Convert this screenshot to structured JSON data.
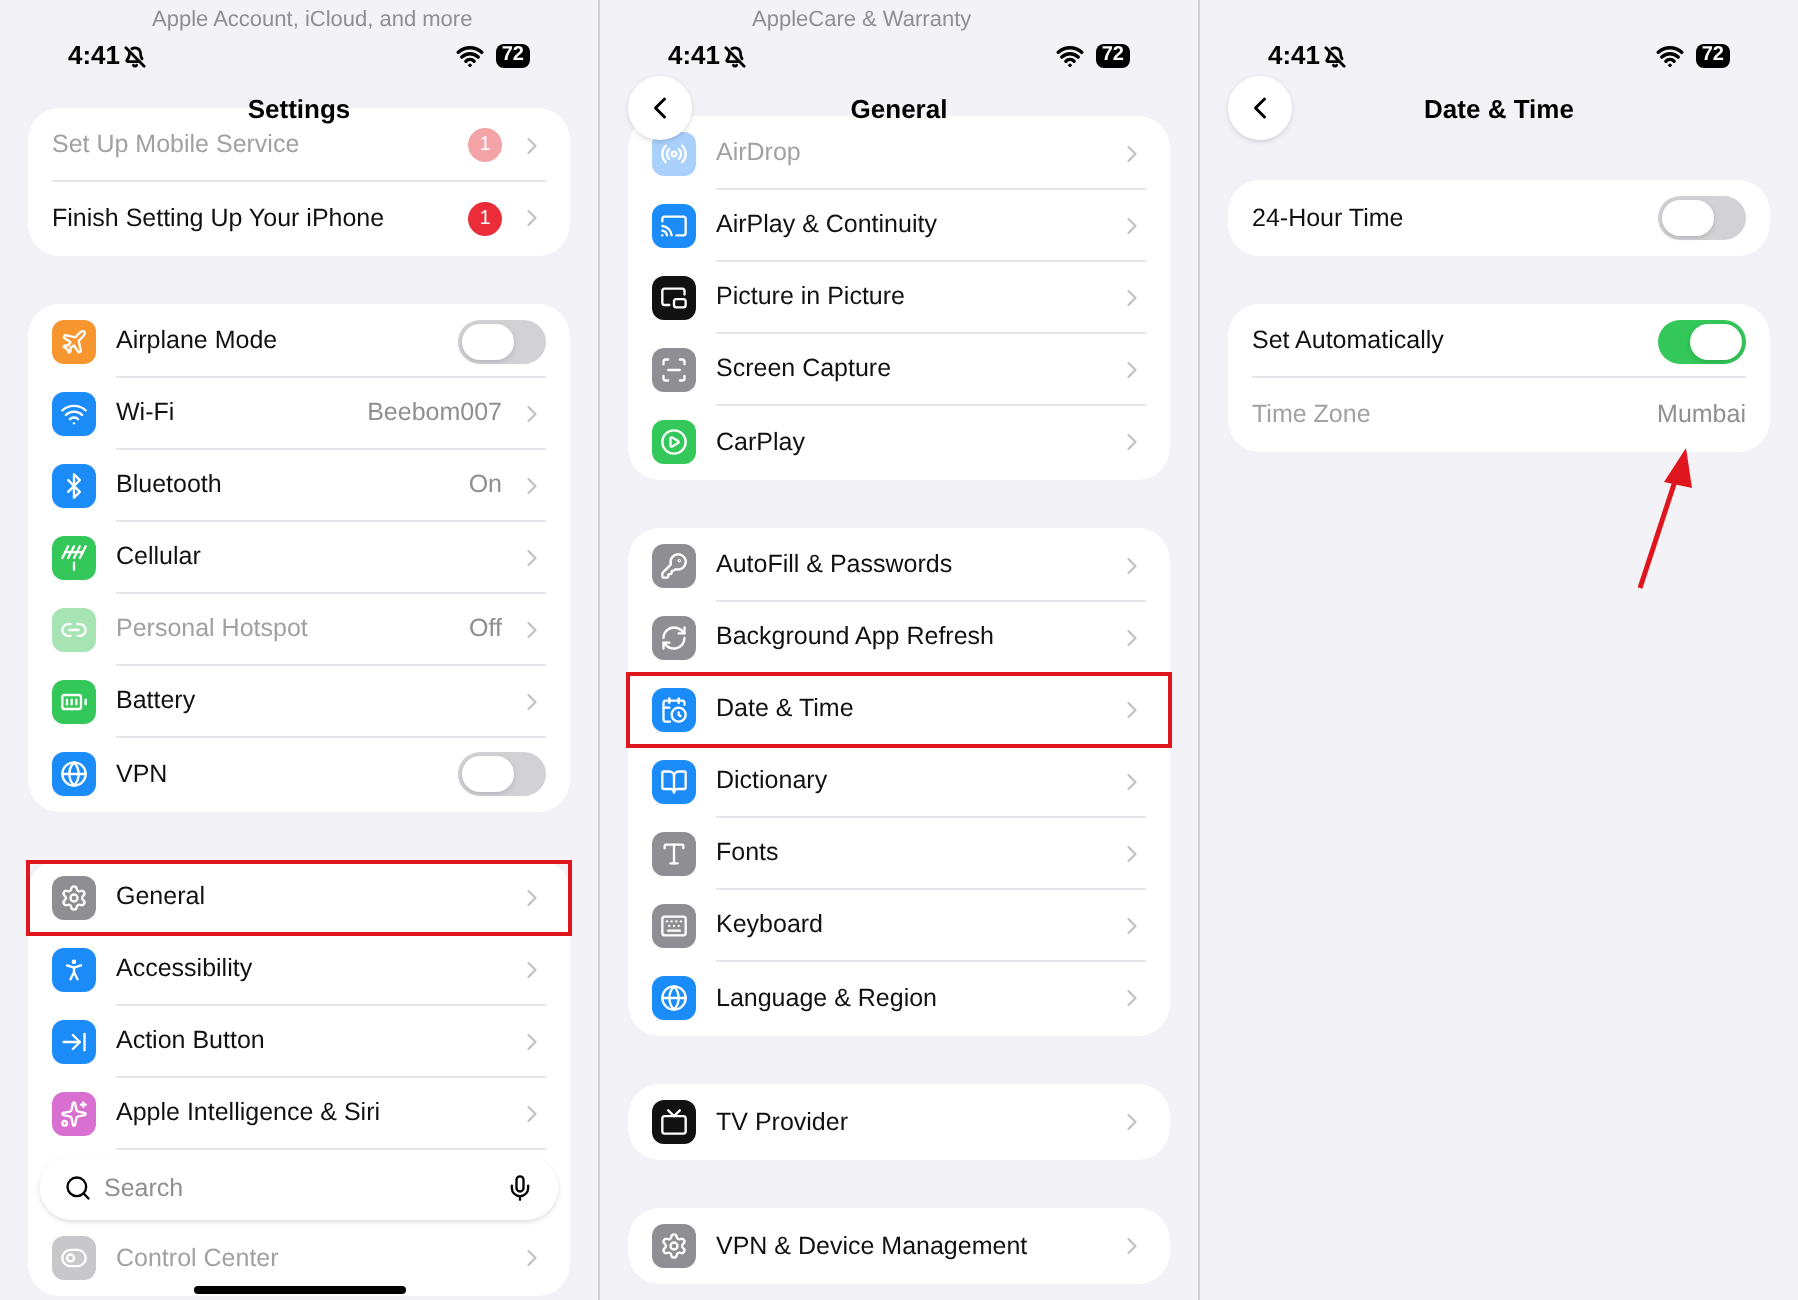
{
  "panels": [
    {
      "scrolled_under": "Apple Account, iCloud, and more",
      "status": {
        "time": "4:41",
        "battery": "72"
      },
      "title": "Settings",
      "groups": [
        {
          "rows": [
            {
              "label": "Set Up Mobile Service",
              "kind": "link",
              "badge": "1",
              "disabled": true,
              "highlighted": false
            },
            {
              "label": "Finish Setting Up Your iPhone",
              "kind": "link",
              "badge": "1",
              "disabled": false,
              "highlighted": false
            }
          ]
        },
        {
          "rows": [
            {
              "label": "Airplane Mode",
              "kind": "toggle",
              "on": false,
              "color": "#f7962f",
              "disabled": false,
              "highlighted": false
            },
            {
              "label": "Wi-Fi",
              "kind": "link",
              "value": "Beebom007",
              "color": "#1b8cf7",
              "disabled": false,
              "highlighted": false
            },
            {
              "label": "Bluetooth",
              "kind": "link",
              "value": "On",
              "color": "#1b8cf7",
              "disabled": false,
              "highlighted": false
            },
            {
              "label": "Cellular",
              "kind": "link",
              "color": "#34c759",
              "disabled": false,
              "highlighted": false
            },
            {
              "label": "Personal Hotspot",
              "kind": "link",
              "value": "Off",
              "color": "#a6e4b4",
              "disabled": true,
              "highlighted": false
            },
            {
              "label": "Battery",
              "kind": "link",
              "color": "#34c759",
              "disabled": false,
              "highlighted": false
            },
            {
              "label": "VPN",
              "kind": "toggle",
              "on": false,
              "color": "#1b8cf7",
              "disabled": false,
              "highlighted": false
            }
          ]
        },
        {
          "rows": [
            {
              "label": "General",
              "kind": "link",
              "color": "#8e8e93",
              "disabled": false,
              "highlighted": true
            },
            {
              "label": "Accessibility",
              "kind": "link",
              "color": "#1b8cf7",
              "disabled": false,
              "highlighted": false
            },
            {
              "label": "Action Button",
              "kind": "link",
              "color": "#1b8cf7",
              "disabled": false,
              "highlighted": false
            },
            {
              "label": "Apple Intelligence & Siri",
              "kind": "link",
              "color": "#d96fd0",
              "disabled": false,
              "highlighted": false
            },
            {
              "kind": "spacer"
            },
            {
              "label": "Control Center",
              "kind": "link",
              "color": "#c7c7cc",
              "disabled": true,
              "highlighted": false
            }
          ]
        }
      ],
      "search": {
        "placeholder": "Search"
      }
    },
    {
      "scrolled_under": "AppleCare & Warranty",
      "status": {
        "time": "4:41",
        "battery": "72"
      },
      "title": "General",
      "back_button": true,
      "groups": [
        {
          "rows": [
            {
              "label": "AirDrop",
              "kind": "link",
              "color": "#a9d1fb",
              "disabled": true,
              "highlighted": false
            },
            {
              "label": "AirPlay & Continuity",
              "kind": "link",
              "color": "#1b8cf7",
              "disabled": false,
              "highlighted": false
            },
            {
              "label": "Picture in Picture",
              "kind": "link",
              "color": "#111111",
              "disabled": false,
              "highlighted": false
            },
            {
              "label": "Screen Capture",
              "kind": "link",
              "color": "#8e8e93",
              "disabled": false,
              "highlighted": false
            },
            {
              "label": "CarPlay",
              "kind": "link",
              "color": "#34c759",
              "disabled": false,
              "highlighted": false
            }
          ]
        },
        {
          "rows": [
            {
              "label": "AutoFill & Passwords",
              "kind": "link",
              "color": "#8e8e93",
              "disabled": false,
              "highlighted": false
            },
            {
              "label": "Background App Refresh",
              "kind": "link",
              "color": "#8e8e93",
              "disabled": false,
              "highlighted": false
            },
            {
              "label": "Date & Time",
              "kind": "link",
              "color": "#1b8cf7",
              "disabled": false,
              "highlighted": true
            },
            {
              "label": "Dictionary",
              "kind": "link",
              "color": "#1b8cf7",
              "disabled": false,
              "highlighted": false
            },
            {
              "label": "Fonts",
              "kind": "link",
              "color": "#8e8e93",
              "disabled": false,
              "highlighted": false
            },
            {
              "label": "Keyboard",
              "kind": "link",
              "color": "#8e8e93",
              "disabled": false,
              "highlighted": false
            },
            {
              "label": "Language & Region",
              "kind": "link",
              "color": "#1b8cf7",
              "disabled": false,
              "highlighted": false
            }
          ]
        },
        {
          "rows": [
            {
              "label": "TV Provider",
              "kind": "link",
              "color": "#111111",
              "disabled": false,
              "highlighted": false
            }
          ]
        },
        {
          "rows": [
            {
              "label": "VPN & Device Management",
              "kind": "link",
              "color": "#8e8e93",
              "disabled": false,
              "highlighted": false
            }
          ]
        }
      ]
    },
    {
      "status": {
        "time": "4:41",
        "battery": "72"
      },
      "title": "Date & Time",
      "back_button": true,
      "groups": [
        {
          "rows": [
            {
              "label": "24-Hour Time",
              "kind": "toggle",
              "on": false,
              "disabled": false,
              "highlighted": false
            }
          ]
        },
        {
          "rows": [
            {
              "label": "Set Automatically",
              "kind": "toggle",
              "on": true,
              "disabled": false,
              "highlighted": false
            },
            {
              "label": "Time Zone",
              "kind": "info",
              "value": "Mumbai",
              "disabled": true,
              "highlighted": false
            }
          ]
        }
      ],
      "arrow": true
    }
  ]
}
